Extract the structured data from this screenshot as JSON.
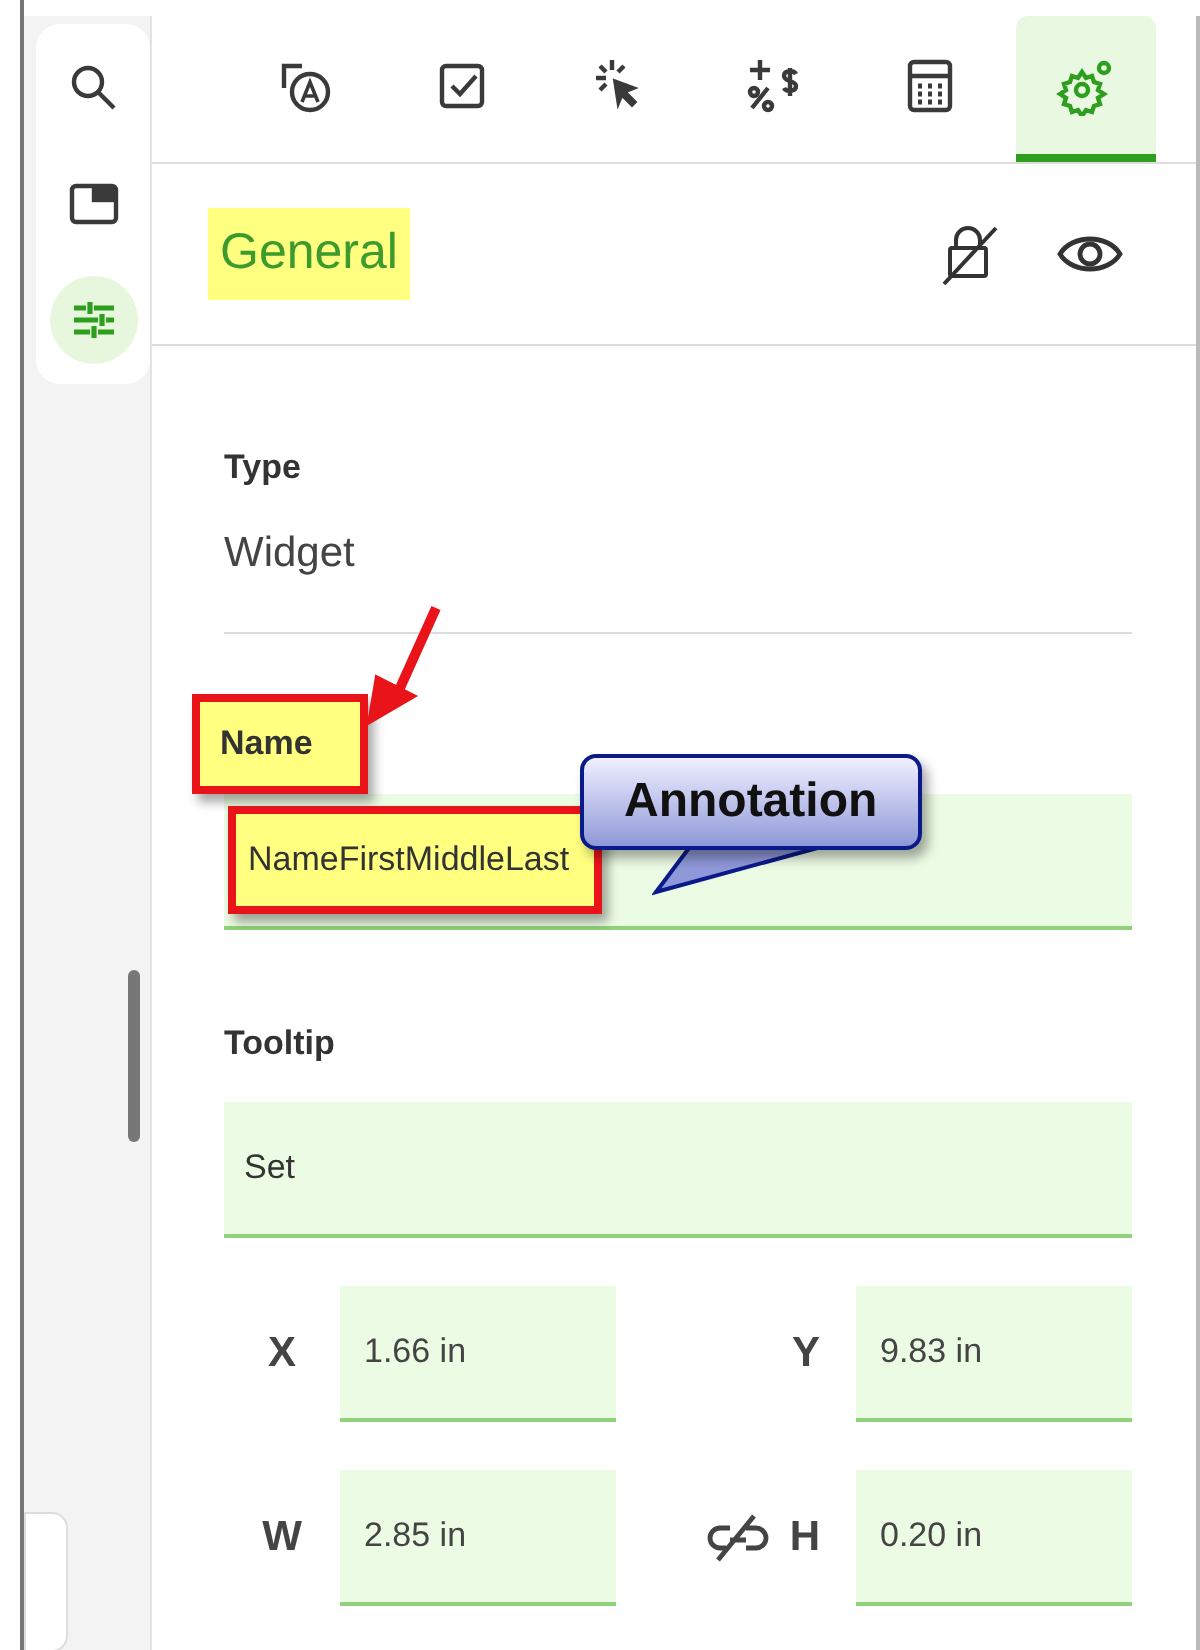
{
  "rail": [
    {
      "selected": false
    },
    {
      "selected": false
    },
    {
      "selected": true
    }
  ],
  "tabs": [
    {
      "selected": false
    },
    {
      "selected": false
    },
    {
      "selected": false
    },
    {
      "selected": false
    },
    {
      "selected": false
    },
    {
      "selected": true
    }
  ],
  "header": {
    "title": "General",
    "highlighted": true
  },
  "type": {
    "label": "Type",
    "value": "Widget"
  },
  "name": {
    "label": "Name",
    "value": "NameFirstMiddleLast",
    "highlighted": true
  },
  "tooltip": {
    "label": "Tooltip",
    "value": "Set"
  },
  "geometry": [
    {
      "label": "X",
      "value": "1.66 in"
    },
    {
      "label": "Y",
      "value": "9.83 in"
    },
    {
      "label": "W",
      "value": "2.85 in"
    },
    {
      "label": "H",
      "value": "0.20 in"
    }
  ],
  "callout": {
    "text": "Annotation"
  }
}
